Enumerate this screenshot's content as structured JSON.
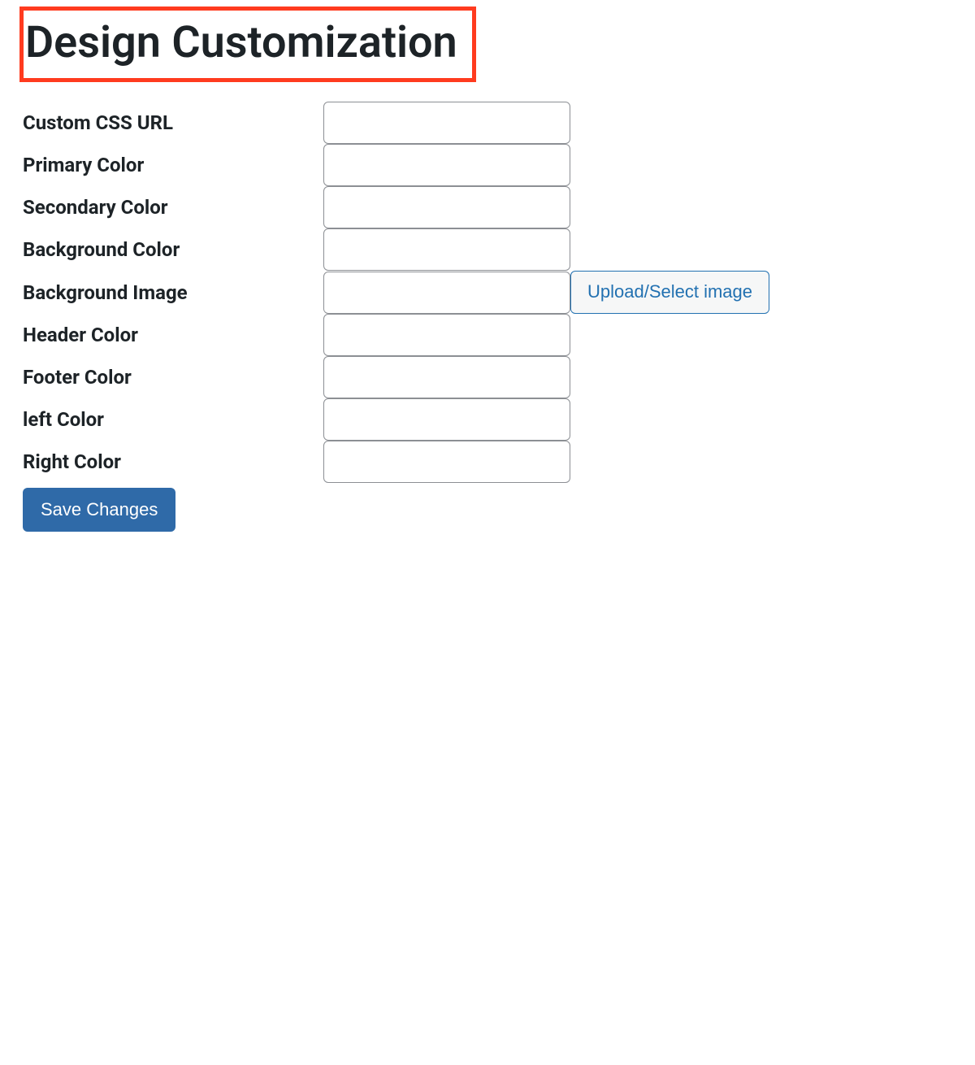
{
  "page": {
    "title": "Design Customization"
  },
  "fields": {
    "custom_css_url": {
      "label": "Custom CSS URL",
      "value": ""
    },
    "primary_color": {
      "label": "Primary Color",
      "value": ""
    },
    "secondary_color": {
      "label": "Secondary Color",
      "value": ""
    },
    "background_color": {
      "label": "Background Color",
      "value": ""
    },
    "background_image": {
      "label": "Background Image",
      "value": "",
      "upload_label": "Upload/Select image"
    },
    "header_color": {
      "label": "Header Color",
      "value": ""
    },
    "footer_color": {
      "label": "Footer Color",
      "value": ""
    },
    "left_color": {
      "label": "left Color",
      "value": ""
    },
    "right_color": {
      "label": "Right Color",
      "value": ""
    }
  },
  "actions": {
    "save_label": "Save Changes"
  }
}
